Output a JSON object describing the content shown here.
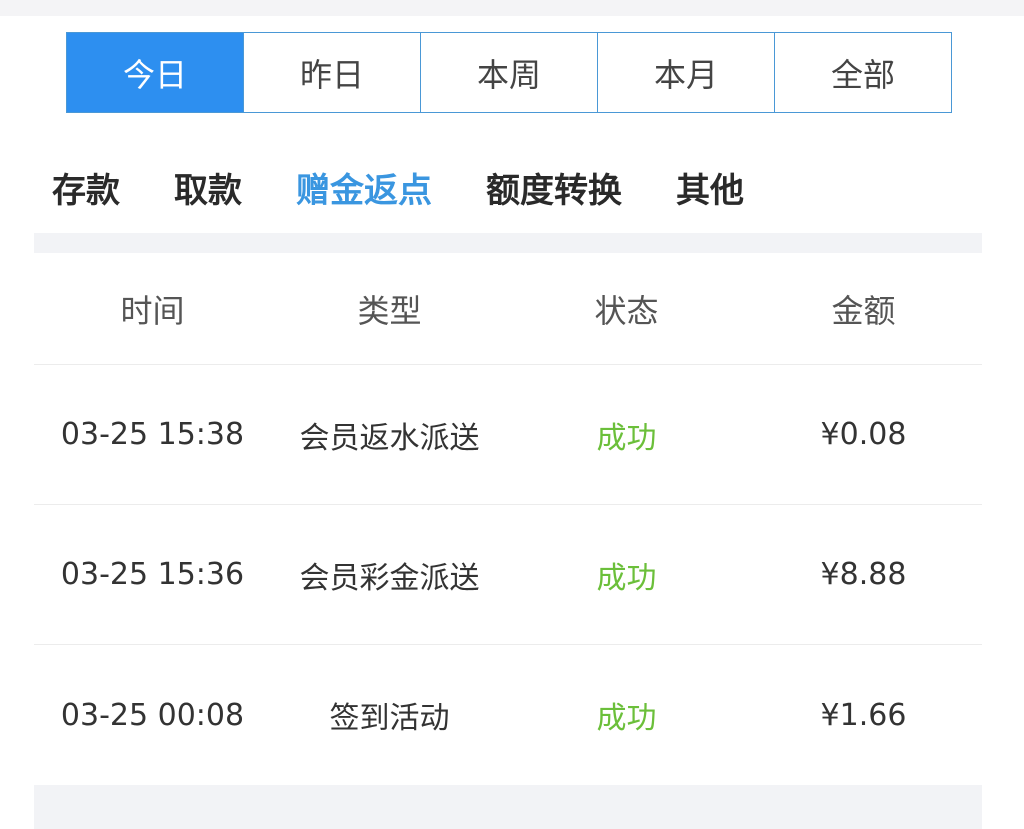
{
  "date_filters": [
    {
      "label": "今日",
      "active": true
    },
    {
      "label": "昨日",
      "active": false
    },
    {
      "label": "本周",
      "active": false
    },
    {
      "label": "本月",
      "active": false
    },
    {
      "label": "全部",
      "active": false
    }
  ],
  "categories": [
    {
      "label": "存款",
      "active": false
    },
    {
      "label": "取款",
      "active": false
    },
    {
      "label": "赠金返点",
      "active": true
    },
    {
      "label": "额度转换",
      "active": false
    },
    {
      "label": "其他",
      "active": false
    }
  ],
  "table": {
    "headers": [
      "时间",
      "类型",
      "状态",
      "金额"
    ],
    "rows": [
      {
        "time": "03-25 15:38",
        "type": "会员返水派送",
        "status": "成功",
        "amount": "¥0.08"
      },
      {
        "time": "03-25 15:36",
        "type": "会员彩金派送",
        "status": "成功",
        "amount": "¥8.88"
      },
      {
        "time": "03-25 00:08",
        "type": "签到活动",
        "status": "成功",
        "amount": "¥1.66"
      }
    ]
  },
  "colors": {
    "accent": "#2d8ff0",
    "active_tab_text": "#3a96e0",
    "success": "#6bbf3a",
    "band": "#f2f3f6"
  }
}
